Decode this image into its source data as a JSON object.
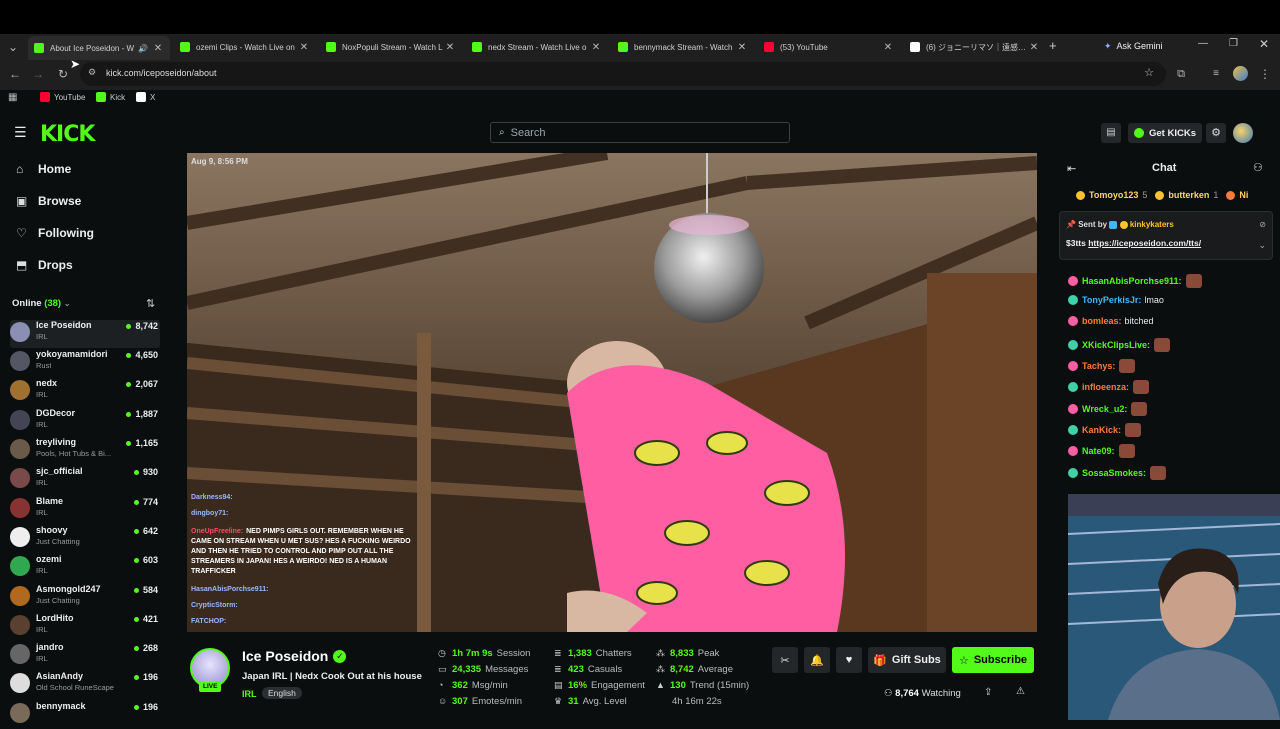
{
  "browser": {
    "tabs": [
      {
        "title": "About Ice Poseidon - W",
        "fav": "#53fc18",
        "active": true
      },
      {
        "title": "ozemi Clips - Watch Live on",
        "fav": "#53fc18"
      },
      {
        "title": "NoxPopuli Stream - Watch L",
        "fav": "#53fc18"
      },
      {
        "title": "nedx Stream - Watch Live o",
        "fav": "#53fc18"
      },
      {
        "title": "bennymack Stream - Watch",
        "fav": "#53fc18"
      },
      {
        "title": "(53) YouTube",
        "fav": "#ff0033"
      },
      {
        "title": "(6) ジョニーリマソ｜遠感外国",
        "fav": "#ffffff"
      }
    ],
    "ask_gemini": "Ask Gemini",
    "url": "kick.com/iceposeidon/about",
    "bookmarks": [
      {
        "label": "YouTube",
        "color": "#ff0033"
      },
      {
        "label": "Kick",
        "color": "#53fc18"
      },
      {
        "label": "X",
        "color": "#ffffff"
      }
    ]
  },
  "kick": {
    "logo": "KICK",
    "search_placeholder": "Search",
    "get_kicks": "Get KICKs",
    "nav": [
      {
        "label": "Home",
        "icon": "home-icon",
        "glyph": "⌂"
      },
      {
        "label": "Browse",
        "icon": "browse-icon",
        "glyph": "▣"
      },
      {
        "label": "Following",
        "icon": "heart-icon",
        "glyph": "♡"
      },
      {
        "label": "Drops",
        "icon": "drops-icon",
        "glyph": "⬒"
      }
    ],
    "online_label": "Online",
    "online_count": "(38)",
    "channels": [
      {
        "name": "Ice Poseidon",
        "category": "IRL",
        "viewers": "8,742",
        "color": "#8a8fb3"
      },
      {
        "name": "yokoyamamidori",
        "category": "Rust",
        "viewers": "4,650",
        "color": "#556"
      },
      {
        "name": "nedx",
        "category": "IRL",
        "viewers": "2,067",
        "color": "#a07030"
      },
      {
        "name": "DGDecor",
        "category": "IRL",
        "viewers": "1,887",
        "color": "#445"
      },
      {
        "name": "treyliving",
        "category": "Pools, Hot Tubs & Bi...",
        "viewers": "1,165",
        "color": "#6a5a4a"
      },
      {
        "name": "sjc_official",
        "category": "IRL",
        "viewers": "930",
        "color": "#7a4a4a"
      },
      {
        "name": "Blame",
        "category": "IRL",
        "viewers": "774",
        "color": "#833"
      },
      {
        "name": "shoovy",
        "category": "Just Chatting",
        "viewers": "642",
        "color": "#eee"
      },
      {
        "name": "ozemi",
        "category": "IRL",
        "viewers": "603",
        "color": "#2fa84f"
      },
      {
        "name": "Asmongold247",
        "category": "Just Chatting",
        "viewers": "584",
        "color": "#b06a20"
      },
      {
        "name": "LordHito",
        "category": "IRL",
        "viewers": "421",
        "color": "#5a4030"
      },
      {
        "name": "jandro",
        "category": "IRL",
        "viewers": "268",
        "color": "#666"
      },
      {
        "name": "AsianAndy",
        "category": "Old School RuneScape",
        "viewers": "196",
        "color": "#ddd"
      },
      {
        "name": "bennymack",
        "category": "",
        "viewers": "196",
        "color": "#7a6a5a"
      }
    ],
    "video_timestamp": "Aug 9, 8:56 PM",
    "overlay_chat": [
      {
        "user": "Darkness94:",
        "text": ""
      },
      {
        "user": "dingboy71:",
        "text": ""
      },
      {
        "user": "OneUpFreeline:",
        "text": "NED PIMPS GIRLS OUT. REMEMBER WHEN HE CAME ON STREAM WHEN U MET SUS? HES A FUCKING WEIRDO AND THEN HE TRIED TO CONTROL AND PIMP OUT ALL THE STREAMERS IN JAPAN! HES A WEIRDO! NED IS A HUMAN TRAFFICKER"
      },
      {
        "user": "HasanAbisPorchse911:",
        "text": ""
      },
      {
        "user": "CrypticStorm:",
        "text": ""
      },
      {
        "user": "FATCHOP:",
        "text": ""
      }
    ],
    "chat": {
      "title": "Chat",
      "top_gifters": [
        {
          "name": "Tomoyo123",
          "count": "5"
        },
        {
          "name": "butterken",
          "count": "1"
        },
        {
          "name": "Ni",
          "count": ""
        }
      ],
      "pinned_sent_by": "Sent by",
      "pinned_user": "kinkykaters",
      "pinned_text": "$3tts",
      "pinned_link": "https://iceposeidon.com/tts/",
      "messages": [
        {
          "user": "HasanAbisPorchse911:",
          "text": "",
          "color": "#53fc18"
        },
        {
          "user": "TonyPerkisJr:",
          "text": "lmao",
          "color": "#3fb8ff"
        },
        {
          "user": "bomleas:",
          "text": "bitched",
          "color": "#ff7a3a"
        },
        {
          "user": "XKickClipsLive:",
          "text": "",
          "color": "#53fc18"
        },
        {
          "user": "Tachys:",
          "text": "",
          "color": "#ff7a3a"
        },
        {
          "user": "infloeenza:",
          "text": "",
          "color": "#ff7a3a"
        },
        {
          "user": "Wreck_u2:",
          "text": "",
          "color": "#53fc18"
        },
        {
          "user": "KanKick:",
          "text": "",
          "color": "#ff7a3a"
        },
        {
          "user": "Nate09:",
          "text": "",
          "color": "#53fc18"
        },
        {
          "user": "SossaSmokes:",
          "text": "",
          "color": "#53fc18"
        }
      ]
    },
    "streamer": {
      "name": "Ice Poseidon",
      "title": "Japan IRL | Nedx Cook Out at his house",
      "category": "IRL",
      "language": "English",
      "live_label": "LIVE"
    },
    "stats": [
      {
        "value": "1h 7m 9s",
        "label": "Session",
        "icon": "clock-icon",
        "glyph": "◷"
      },
      {
        "value": "24,335",
        "label": "Messages",
        "icon": "messages-icon",
        "glyph": "▭"
      },
      {
        "value": "362",
        "label": "Msg/min",
        "icon": "speed-icon",
        "glyph": "◔"
      },
      {
        "value": "307",
        "label": "Emotes/min",
        "icon": "emote-icon",
        "glyph": "☺"
      },
      {
        "value": "1,383",
        "label": "Chatters",
        "icon": "chatters-icon",
        "glyph": "≣"
      },
      {
        "value": "423",
        "label": "Casuals",
        "icon": "casuals-icon",
        "glyph": "≣"
      },
      {
        "value": "16%",
        "label": "Engagement",
        "icon": "engagement-icon",
        "glyph": "▤"
      },
      {
        "value": "31",
        "label": "Avg. Level",
        "icon": "trophy-icon",
        "glyph": "♛"
      },
      {
        "value": "8,833",
        "label": "Peak",
        "icon": "peak-icon",
        "glyph": "⁂"
      },
      {
        "value": "8,742",
        "label": "Average",
        "icon": "average-icon",
        "glyph": "⁂"
      },
      {
        "value": "130",
        "label": "Trend (15min)",
        "icon": "trend-icon",
        "glyph": "▲"
      },
      {
        "value": "4h 16m 22s",
        "label": "",
        "icon": "",
        "glyph": ""
      }
    ],
    "gift_subs": "Gift Subs",
    "subscribe": "Subscribe",
    "watching_count": "8,764",
    "watching_label": "Watching"
  },
  "colors": {
    "accent": "#53fc18"
  }
}
